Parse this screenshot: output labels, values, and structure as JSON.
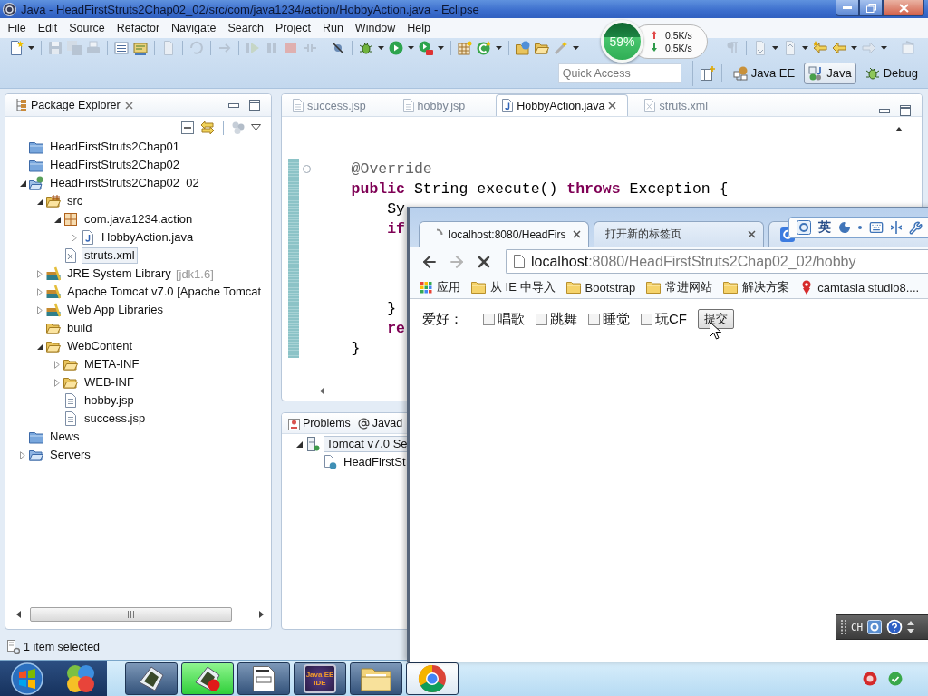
{
  "window": {
    "title": "Java - HeadFirstStruts2Chap02_02/src/com/java1234/action/HobbyAction.java - Eclipse"
  },
  "menu": [
    "File",
    "Edit",
    "Source",
    "Refactor",
    "Navigate",
    "Search",
    "Project",
    "Run",
    "Window",
    "Help"
  ],
  "quick_access": {
    "placeholder": "Quick Access"
  },
  "perspectives": [
    {
      "label": "Java EE",
      "kind": "javaee",
      "selected": false
    },
    {
      "label": "Java",
      "kind": "java",
      "selected": true
    },
    {
      "label": "Debug",
      "kind": "debug",
      "selected": false
    }
  ],
  "net_monitor": {
    "percent": "59%",
    "upload": "0.5K/s",
    "download": "0.5K/s"
  },
  "package_explorer": {
    "title": "Package Explorer",
    "tree": [
      {
        "label": "HeadFirstStruts2Chap01",
        "kind": "closed-project",
        "selected": false
      },
      {
        "label": "HeadFirstStruts2Chap02",
        "kind": "closed-project",
        "selected": false
      },
      {
        "label": "HeadFirstStruts2Chap02_02",
        "kind": "web-project",
        "expanded": true,
        "selected": false,
        "children": [
          {
            "label": "src",
            "kind": "source-folder",
            "expanded": true,
            "selected": false,
            "children": [
              {
                "label": "com.java1234.action",
                "kind": "package",
                "expanded": true,
                "selected": false,
                "children": [
                  {
                    "label": "HobbyAction.java",
                    "kind": "java-file",
                    "expanded": false,
                    "selected": false
                  }
                ]
              },
              {
                "label": "struts.xml",
                "kind": "xml-file",
                "selected": true
              }
            ]
          },
          {
            "label": "JRE System Library",
            "decoration": "[jdk1.6]",
            "kind": "library",
            "expanded": false,
            "selected": false
          },
          {
            "label": "Apache Tomcat v7.0 [Apache Tomcat",
            "kind": "library",
            "expanded": false,
            "selected": false
          },
          {
            "label": "Web App Libraries",
            "kind": "library",
            "expanded": false,
            "selected": false
          },
          {
            "label": "build",
            "kind": "folder",
            "selected": false
          },
          {
            "label": "WebContent",
            "kind": "folder",
            "expanded": true,
            "selected": false,
            "children": [
              {
                "label": "META-INF",
                "kind": "folder",
                "expanded": false,
                "selected": false
              },
              {
                "label": "WEB-INF",
                "kind": "folder",
                "expanded": false,
                "selected": false
              },
              {
                "label": "hobby.jsp",
                "kind": "text-file",
                "selected": false
              },
              {
                "label": "success.jsp",
                "kind": "text-file",
                "selected": false
              }
            ]
          }
        ]
      },
      {
        "label": "News",
        "kind": "closed-project",
        "selected": false
      },
      {
        "label": "Servers",
        "kind": "folder-project",
        "expanded": false,
        "selected": false
      }
    ]
  },
  "editor": {
    "tabs": [
      {
        "label": "success.jsp",
        "kind": "jsp",
        "selected": false
      },
      {
        "label": "hobby.jsp",
        "kind": "jsp",
        "selected": false
      },
      {
        "label": "HobbyAction.java",
        "kind": "java",
        "selected": true
      },
      {
        "label": "struts.xml",
        "kind": "xml",
        "selected": false
      }
    ],
    "lines": [
      {
        "kind": "blank",
        "fold": false
      },
      {
        "kind": "blank",
        "fold": false
      },
      {
        "kind": "code",
        "fold": true,
        "tokens": [
          {
            "text": "    @Override",
            "kind": "annotation"
          }
        ]
      },
      {
        "kind": "code",
        "fold": false,
        "tokens": [
          {
            "text": "    public",
            "kind": "keyword"
          },
          {
            "text": " String execute() ",
            "kind": "plain"
          },
          {
            "text": "throws",
            "kind": "keyword"
          },
          {
            "text": " Exception {",
            "kind": "plain"
          }
        ]
      },
      {
        "kind": "code",
        "fold": false,
        "tokens": [
          {
            "text": "        Sy",
            "kind": "plain"
          }
        ]
      },
      {
        "kind": "code",
        "fold": false,
        "tokens": [
          {
            "text": "        if",
            "kind": "keyword"
          }
        ]
      },
      {
        "kind": "blank",
        "fold": false
      },
      {
        "kind": "blank",
        "fold": false
      },
      {
        "kind": "blank",
        "fold": false
      },
      {
        "kind": "code",
        "fold": false,
        "tokens": [
          {
            "text": "        }",
            "kind": "plain"
          }
        ]
      },
      {
        "kind": "code",
        "fold": false,
        "tokens": [
          {
            "text": "        re",
            "kind": "keyword"
          }
        ]
      },
      {
        "kind": "code",
        "fold": false,
        "tokens": [
          {
            "text": "    }",
            "kind": "plain"
          }
        ]
      }
    ]
  },
  "bottom_panel": {
    "tabs": [
      {
        "label": "Problems",
        "kind": "problems",
        "selected": false
      },
      {
        "label": "Javad",
        "kind": "javadoc",
        "selected": false
      }
    ],
    "tree": [
      {
        "label": "Tomcat v7.0 Se",
        "kind": "server",
        "expanded": true,
        "selected": true,
        "children": [
          {
            "label": "HeadFirstSt",
            "kind": "module",
            "selected": false
          }
        ]
      }
    ]
  },
  "status_bar": {
    "text": "1 item selected"
  },
  "browser": {
    "tabs": [
      {
        "label": "localhost:8080/HeadFirs",
        "kind": "loading",
        "selected": true
      },
      {
        "label": "打开新的标签页",
        "kind": "blank",
        "selected": false
      },
      {
        "kind": "site",
        "selected": false
      }
    ],
    "address": {
      "host": "localhost",
      "path": ":8080/HeadFirstStruts2Chap02_02/hobby"
    },
    "bookmarks": [
      {
        "label": "应用",
        "kind": "apps"
      },
      {
        "label": "从 IE 中导入",
        "kind": "folder"
      },
      {
        "label": "Bootstrap",
        "kind": "folder"
      },
      {
        "label": "常进网站",
        "kind": "folder"
      },
      {
        "label": "解决方案",
        "kind": "folder"
      },
      {
        "label": "camtasia studio8....",
        "kind": "site"
      }
    ],
    "page": {
      "label": "爱好：",
      "options": [
        {
          "label": "唱歌",
          "checked": false
        },
        {
          "label": "跳舞",
          "checked": false
        },
        {
          "label": "睡觉",
          "checked": false
        },
        {
          "label": "玩CF",
          "checked": false
        }
      ],
      "submit": "提交"
    }
  },
  "ime_toolbar": {
    "mode": "英"
  },
  "language_bar": {
    "label": "CH"
  },
  "taskbar": {
    "launchers": [
      {
        "kind": "start"
      },
      {
        "kind": "pinwheel"
      }
    ],
    "tasks": [
      {
        "kind": "recorder",
        "active": false,
        "flashing": false
      },
      {
        "kind": "recorder-rec",
        "active": false,
        "flashing": true
      },
      {
        "kind": "document",
        "active": false,
        "flashing": false
      },
      {
        "kind": "ide",
        "label": "Java EE IDE",
        "active": false,
        "flashing": false
      },
      {
        "kind": "explorer",
        "active": false,
        "flashing": false
      },
      {
        "kind": "round-logo",
        "active": true,
        "flashing": false
      }
    ]
  }
}
